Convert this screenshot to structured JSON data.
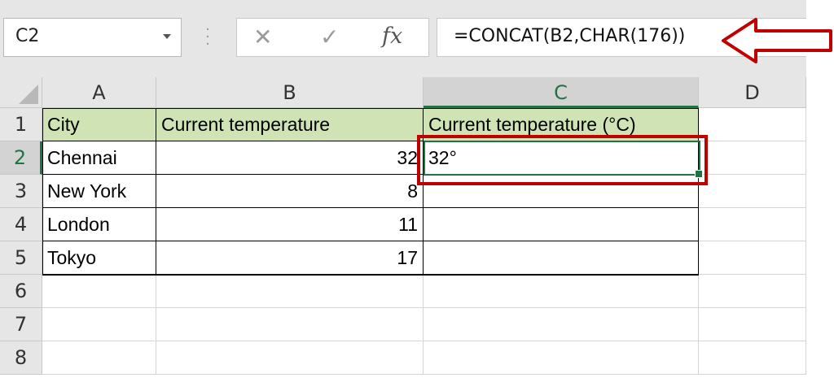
{
  "name_box": {
    "value": "C2"
  },
  "formula_bar": {
    "formula": "=CONCAT(B2,CHAR(176))"
  },
  "icons": {
    "cancel": "✕",
    "enter": "✓",
    "function": "fx"
  },
  "columns": [
    "A",
    "B",
    "C",
    "D"
  ],
  "rows": [
    "1",
    "2",
    "3",
    "4",
    "5",
    "6",
    "7",
    "8"
  ],
  "table": {
    "headers": {
      "a": "City",
      "b": "Current temperature",
      "c": "Current temperature (°C)"
    },
    "rows": [
      {
        "a": "Chennai",
        "b": "32",
        "c": "32°"
      },
      {
        "a": "New York",
        "b": "8",
        "c": ""
      },
      {
        "a": "London",
        "b": "11",
        "c": ""
      },
      {
        "a": "Tokyo",
        "b": "17",
        "c": ""
      }
    ]
  },
  "colors": {
    "header_fill": "#cfe3b4",
    "selection": "#217346",
    "highlight": "#c00000"
  },
  "selected_cell": "C2"
}
